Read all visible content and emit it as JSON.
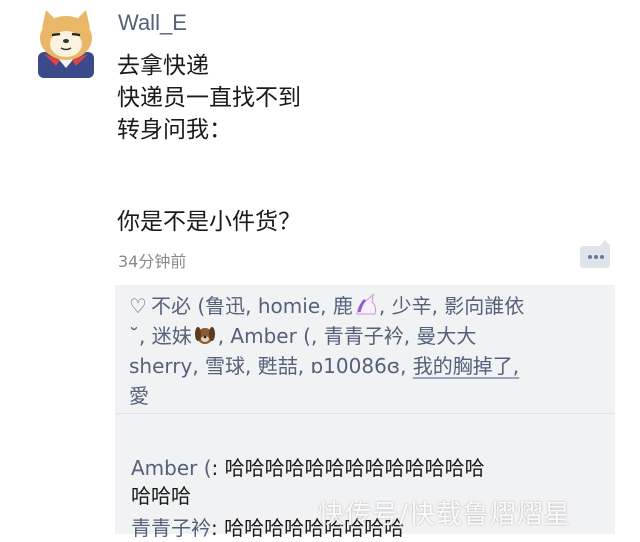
{
  "post": {
    "username": "Wall_E",
    "text_lines": [
      "去拿快递",
      "快递员一直找不到",
      "转身问我："
    ],
    "punchline": "你是不是小件货？",
    "timestamp": "34分钟前"
  },
  "likes": {
    "line1": "不必 (鲁迅, homie, 鹿",
    "line1b": ", 少辛, 影向誰依",
    "line2a": "˘",
    "line2b": ", 迷妹",
    "line2c": ", Amber (, 青青子衿, 曼大大",
    "line3a": "sherry, 雪球, 甦喆, ɒ10086ɞ, ",
    "line3b": "我的胸掉了,",
    "line4": "愛"
  },
  "comments": [
    {
      "author": "Amber (",
      "sep": ": ",
      "text_line1": "哈哈哈哈哈哈哈哈哈哈哈哈哈",
      "text_line2": "哈哈哈"
    },
    {
      "author": "青青子衿",
      "sep": ": ",
      "text_line1": "哈哈哈哈哈哈哈哈哈"
    }
  ],
  "watermark": "快传号/快载鲁熠熠星",
  "icons": {
    "avatar": "shiba-dog-avatar",
    "more": "more-dots-icon",
    "like": "heart-outline-icon",
    "unicorn": "unicorn-emoji",
    "dog": "dog-emoji"
  },
  "colors": {
    "link": "#55607a",
    "panel": "#f1f2f4",
    "timestamp": "#8a8a8a"
  }
}
